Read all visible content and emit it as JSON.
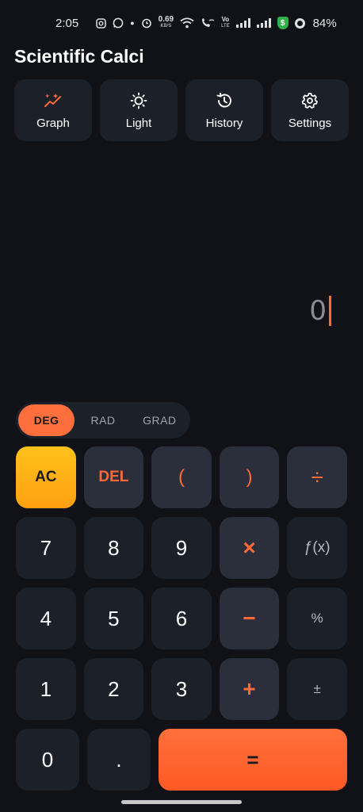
{
  "status_bar": {
    "time": "2:05",
    "net_speed_value": "0.69",
    "net_speed_unit": "KB/S",
    "volte_top": "Vo",
    "volte_bottom": "LTE",
    "battery": "84%"
  },
  "header": {
    "title": "Scientific Calci"
  },
  "actions": [
    {
      "label": "Graph",
      "icon": "graph-icon"
    },
    {
      "label": "Light",
      "icon": "sun-icon"
    },
    {
      "label": "History",
      "icon": "history-icon"
    },
    {
      "label": "Settings",
      "icon": "gear-icon"
    }
  ],
  "display": {
    "value": "0"
  },
  "angle_modes": {
    "deg": "DEG",
    "rad": "RAD",
    "grad": "GRAD",
    "selected": "DEG"
  },
  "keys": {
    "ac": "AC",
    "del": "DEL",
    "open_paren": "(",
    "close_paren": ")",
    "divide": "÷",
    "seven": "7",
    "eight": "8",
    "nine": "9",
    "multiply": "×",
    "function": "ƒ(x)",
    "four": "4",
    "five": "5",
    "six": "6",
    "minus": "−",
    "percent": "%",
    "one": "1",
    "two": "2",
    "three": "3",
    "plus": "+",
    "plus_minus": "±",
    "zero": "0",
    "dot": ".",
    "equals": "="
  },
  "colors": {
    "background": "#101218",
    "accent": "#ff6a35",
    "ac_key": "#ffb015",
    "key_bg": "#1c2029",
    "operator_key_bg": "#2b2f3b"
  }
}
